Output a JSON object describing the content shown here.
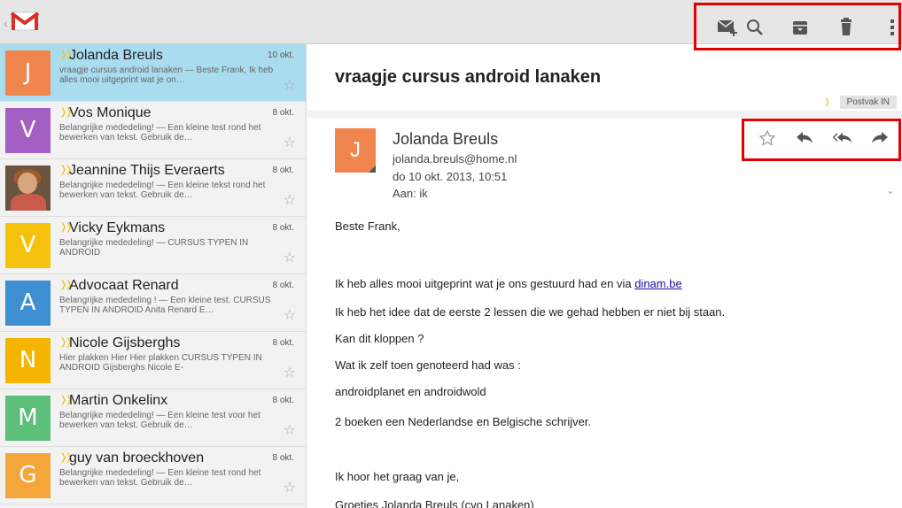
{
  "topbar": {
    "actions": [
      {
        "name": "compose-icon"
      },
      {
        "name": "search-icon"
      },
      {
        "name": "archive-icon"
      },
      {
        "name": "delete-icon"
      },
      {
        "name": "overflow-menu-icon"
      }
    ],
    "highlight_color": "#e50000"
  },
  "conversations": [
    {
      "sender": "Jolanda Breuls",
      "date": "10 okt.",
      "snippet": "vraagje cursus android lanaken — Beste Frank, Ik heb alles mooi uitgeprint wat je on…",
      "avatar_letter": "J",
      "avatar_color": "#f0854e",
      "selected": true
    },
    {
      "sender": "Vos Monique",
      "date": "8 okt.",
      "snippet": "Belangrijke mededeling! — Een kleine test rond het bewerken van tekst. Gebruik de…",
      "avatar_letter": "V",
      "avatar_color": "#a35fc1",
      "selected": false
    },
    {
      "sender": "Jeannine Thijs Everaerts",
      "date": "8 okt.",
      "snippet": "Belangrijke mededeling! — Een kleine tekst rond het bewerken van tekst. Gebruik de…",
      "avatar_letter": "",
      "avatar_color": "#6a5440",
      "selected": false,
      "photo": true
    },
    {
      "sender": "Vicky Eykmans",
      "date": "8 okt.",
      "snippet": "Belangrijke mededeling! — CURSUS TYPEN IN ANDROID",
      "avatar_letter": "V",
      "avatar_color": "#f4c20d",
      "selected": false
    },
    {
      "sender": "Advocaat Renard",
      "date": "8 okt.",
      "snippet": "Belangrijke mededeling ! — Een kleine test. CURSUS TYPEN IN ANDROID Anita Renard E…",
      "avatar_letter": "A",
      "avatar_color": "#3d8fd1",
      "selected": false
    },
    {
      "sender": "Nicole Gijsberghs",
      "date": "8 okt.",
      "snippet": "Hier plakken Hier Hier plakken CURSUS TYPEN IN ANDROID Gijsberghs Nicole E-",
      "avatar_letter": "N",
      "avatar_color": "#f4b400",
      "selected": false
    },
    {
      "sender": "Martin Onkelinx",
      "date": "8 okt.",
      "snippet": "Belangrijke mededeling! — Een kleine test voor het bewerken van tekst. Gebruik de…",
      "avatar_letter": "M",
      "avatar_color": "#5cbf7a",
      "selected": false
    },
    {
      "sender": "guy van broeckhoven",
      "date": "8 okt.",
      "snippet": "Belangrijke mededeling! — Een kleine test rond het bewerken van tekst. Gebruik de…",
      "avatar_letter": "G",
      "avatar_color": "#f5a63a",
      "selected": false
    }
  ],
  "message": {
    "subject": "vraagje cursus android lanaken",
    "label": "Postvak IN",
    "from_name": "Jolanda Breuls",
    "from_initial": "J",
    "from_email": "jolanda.breuls@home.nl",
    "date": "do 10 okt. 2013, 10:51",
    "to": "Aan: ik",
    "body": {
      "greeting": "Beste Frank,",
      "line1_prefix": "Ik heb alles mooi uitgeprint wat je ons gestuurd had en via ",
      "line1_link": "dinam.be",
      "line2": "Ik heb het idee dat de eerste  2 lessen die we gehad hebben er niet bij staan.",
      "line3": "Kan dit kloppen ?",
      "line4": "Wat ik zelf toen genoteerd had was :",
      "line5": "androidplanet en androidwold",
      "line6": "2 boeken een Nederlandse en Belgische schrijver.",
      "line7": "Ik hoor het graag van je,",
      "line8": "Groeties Jolanda Breuls (cvo Lanaken)"
    }
  },
  "message_actions": [
    {
      "name": "star-icon"
    },
    {
      "name": "reply-icon"
    },
    {
      "name": "reply-all-icon"
    },
    {
      "name": "forward-icon"
    }
  ],
  "colors": {
    "selected_row": "#a9dcef",
    "important_marker": "#f0c419",
    "link": "#1a0dab"
  }
}
